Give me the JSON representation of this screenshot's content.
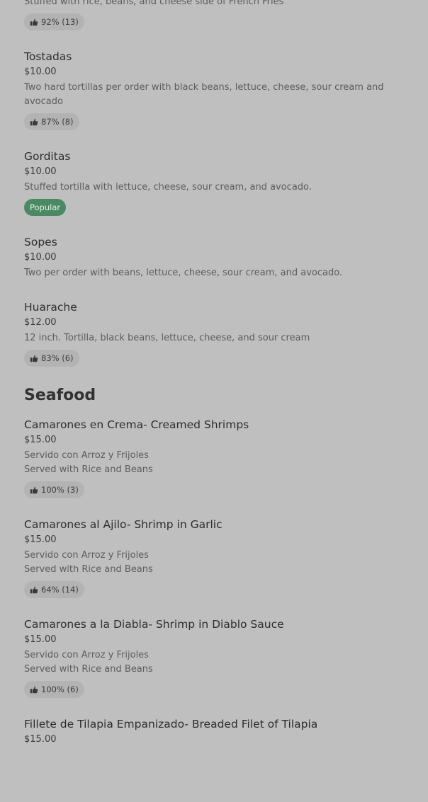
{
  "sections": [
    {
      "title": "",
      "items": [
        {
          "name": "",
          "price": "",
          "description": "Stuffed with rice, beans, and cheese side of French Fries",
          "rating": "92% (13)",
          "badge": ""
        },
        {
          "name": "Tostadas",
          "price": "$10.00",
          "description": "Two hard tortillas per order with black beans, lettuce, cheese, sour cream and avocado",
          "rating": "87% (8)",
          "badge": ""
        },
        {
          "name": "Gorditas",
          "price": "$10.00",
          "description": "Stuffed tortilla with lettuce, cheese, sour cream, and avocado.",
          "rating": "",
          "badge": "Popular"
        },
        {
          "name": "Sopes",
          "price": "$10.00",
          "description": "Two per order with beans, lettuce, cheese, sour cream, and avocado.",
          "rating": "",
          "badge": ""
        },
        {
          "name": "Huarache",
          "price": "$12.00",
          "description": "12 inch. Tortilla, black beans, lettuce, cheese, and sour cream",
          "rating": "83% (6)",
          "badge": ""
        }
      ]
    },
    {
      "title": "Seafood",
      "items": [
        {
          "name": "Camarones en Crema- Creamed Shrimps",
          "price": "$15.00",
          "description": "Servido con Arroz y Frijoles\nServed with Rice and Beans",
          "rating": "100% (3)",
          "badge": ""
        },
        {
          "name": "Camarones al Ajilo- Shrimp in Garlic",
          "price": "$15.00",
          "description": "Servido con Arroz y Frijoles\nServed with Rice and Beans",
          "rating": "64% (14)",
          "badge": ""
        },
        {
          "name": "Camarones a la Diabla- Shrimp in Diablo Sauce",
          "price": "$15.00",
          "description": "Servido con Arroz y Frijoles\nServed with Rice and Beans",
          "rating": "100% (6)",
          "badge": ""
        },
        {
          "name": "Fillete de Tilapia Empanizado- Breaded Filet of Tilapia",
          "price": "$15.00",
          "description": "",
          "rating": "",
          "badge": ""
        }
      ]
    }
  ],
  "icons": {
    "rating": "thumbs-up-icon"
  },
  "colors": {
    "background": "#bfbfbf",
    "popular_badge": "#4a8a63",
    "rating_badge": "#b3b3b3"
  }
}
